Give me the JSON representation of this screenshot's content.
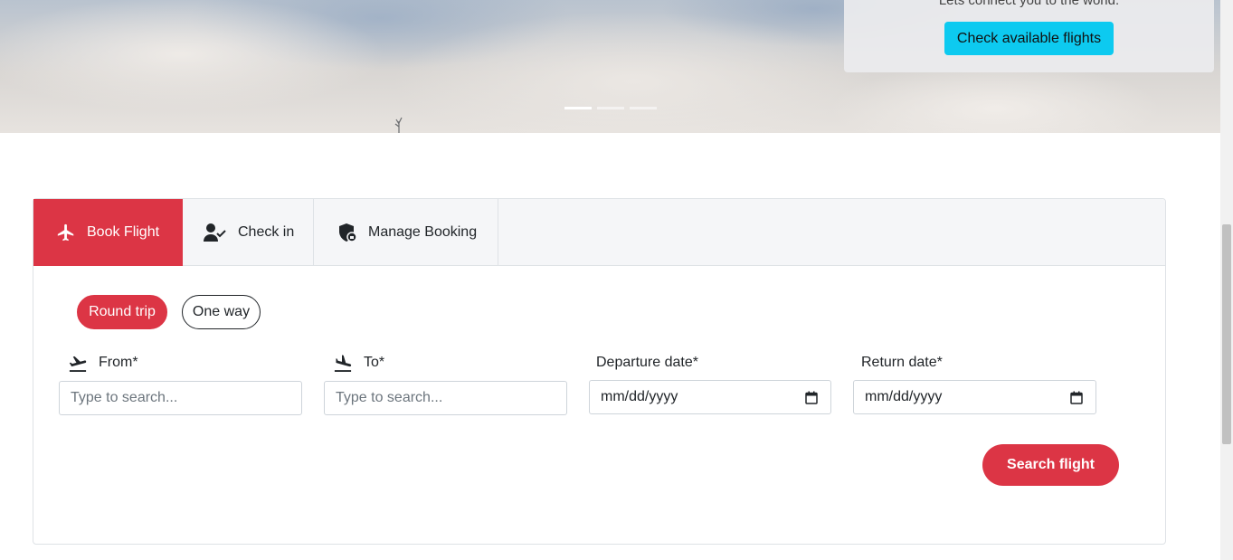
{
  "hero": {
    "tagline": "Lets connect you to the world.",
    "cta_label": "Check available flights",
    "slides": [
      {
        "active": true
      },
      {
        "active": false
      },
      {
        "active": false
      }
    ]
  },
  "tabs": [
    {
      "label": "Book Flight",
      "icon": "airplane-icon",
      "active": true
    },
    {
      "label": "Check in",
      "icon": "user-check-icon",
      "active": false
    },
    {
      "label": "Manage Booking",
      "icon": "shield-lock-icon",
      "active": false
    }
  ],
  "trip_type": {
    "round_trip": "Round trip",
    "one_way": "One way",
    "selected": "Round trip"
  },
  "fields": {
    "from": {
      "label": "From*",
      "placeholder": "Type to search...",
      "icon": "plane-departure-icon"
    },
    "to": {
      "label": "To*",
      "placeholder": "Type to search...",
      "icon": "plane-arrival-icon"
    },
    "departure": {
      "label": "Departure date*",
      "value": "mm/dd/yyyy",
      "icon": "calendar-icon"
    },
    "return": {
      "label": "Return date*",
      "value": "mm/dd/yyyy",
      "icon": "calendar-icon"
    }
  },
  "search_label": "Search flight",
  "colors": {
    "primary": "#dc3545",
    "info": "#0dcaf0"
  }
}
